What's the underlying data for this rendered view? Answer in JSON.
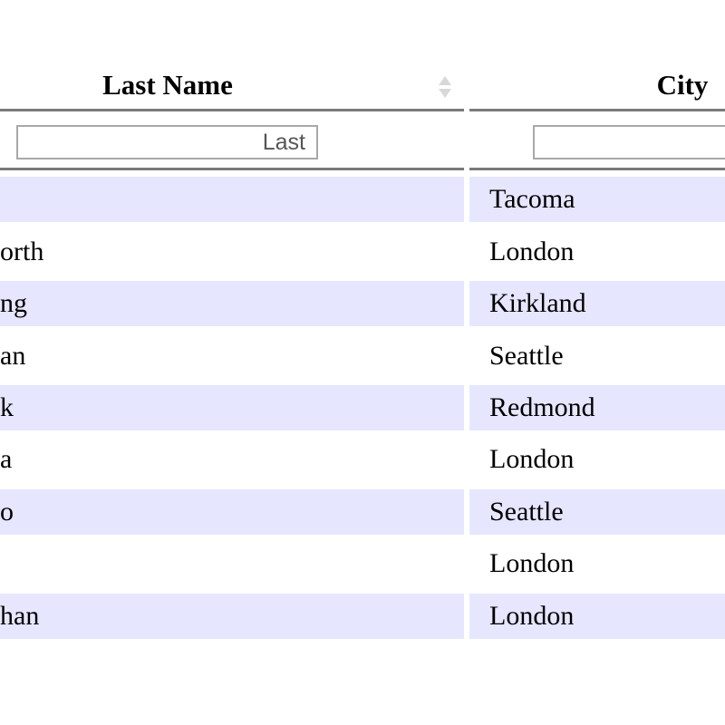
{
  "table": {
    "columns": [
      {
        "key": "last_name",
        "label": "Last Name",
        "sortable": true,
        "filter_placeholder": "Last"
      },
      {
        "key": "city",
        "label": "City",
        "filter_placeholder": ""
      }
    ],
    "rows": [
      {
        "last_name_visible": "",
        "city": "Tacoma"
      },
      {
        "last_name_visible": "orth",
        "city": "London"
      },
      {
        "last_name_visible": "ng",
        "city": "Kirkland"
      },
      {
        "last_name_visible": "an",
        "city": "Seattle"
      },
      {
        "last_name_visible": "k",
        "city": "Redmond"
      },
      {
        "last_name_visible": "a",
        "city": "London"
      },
      {
        "last_name_visible": "o",
        "city": "Seattle"
      },
      {
        "last_name_visible": "",
        "city": "London"
      },
      {
        "last_name_visible": "han",
        "city": "London"
      }
    ]
  },
  "colors": {
    "row_stripe": "#e6e6ff",
    "divider": "#7a7a7a",
    "input_border": "#a8a8a8"
  },
  "icons": {
    "sort": "sort-both-icon"
  }
}
